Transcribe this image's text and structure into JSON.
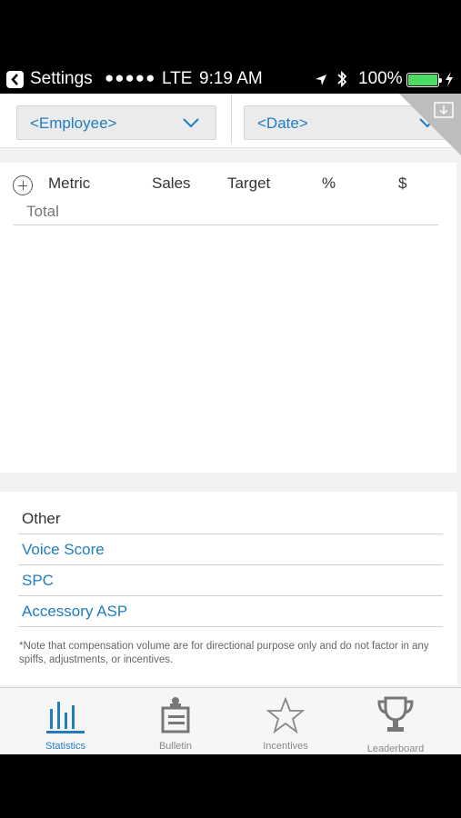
{
  "status_bar": {
    "back_label": "Settings",
    "signal": "●●●●●",
    "carrier": "LTE",
    "time": "9:19 AM",
    "battery": "100%",
    "battery_level": 1.0,
    "icons": [
      "back-arrow-icon",
      "location-arrow-icon",
      "bluetooth-icon",
      "battery-icon",
      "charging-bolt-icon"
    ]
  },
  "filters": {
    "employee": {
      "label": "<Employee>",
      "icon": "chevron-down-icon"
    },
    "date": {
      "label": "<Date>",
      "icon": "chevron-down-icon"
    },
    "corner_icon": "download-icon"
  },
  "metrics": {
    "add_icon": "plus-circle-icon",
    "columns": [
      "Metric",
      "Sales",
      "Target",
      "%",
      "$"
    ],
    "total_label": "Total"
  },
  "other": {
    "heading": "Other",
    "items": [
      "Voice Score",
      "SPC",
      "Accessory ASP"
    ],
    "note": "*Note that compensation volume are for directional purpose only and do not factor in any spiffs, adjustments, or incentives."
  },
  "tabs": [
    {
      "label": "Statistics",
      "icon": "bar-chart-icon",
      "active": true
    },
    {
      "label": "Bulletin",
      "icon": "clipboard-icon",
      "active": false
    },
    {
      "label": "Incentives",
      "icon": "star-icon",
      "active": false
    },
    {
      "label": "Leaderboard",
      "icon": "trophy-icon",
      "active": false
    }
  ],
  "colors": {
    "accent": "#1f7dc2",
    "battery": "#4cd964"
  }
}
